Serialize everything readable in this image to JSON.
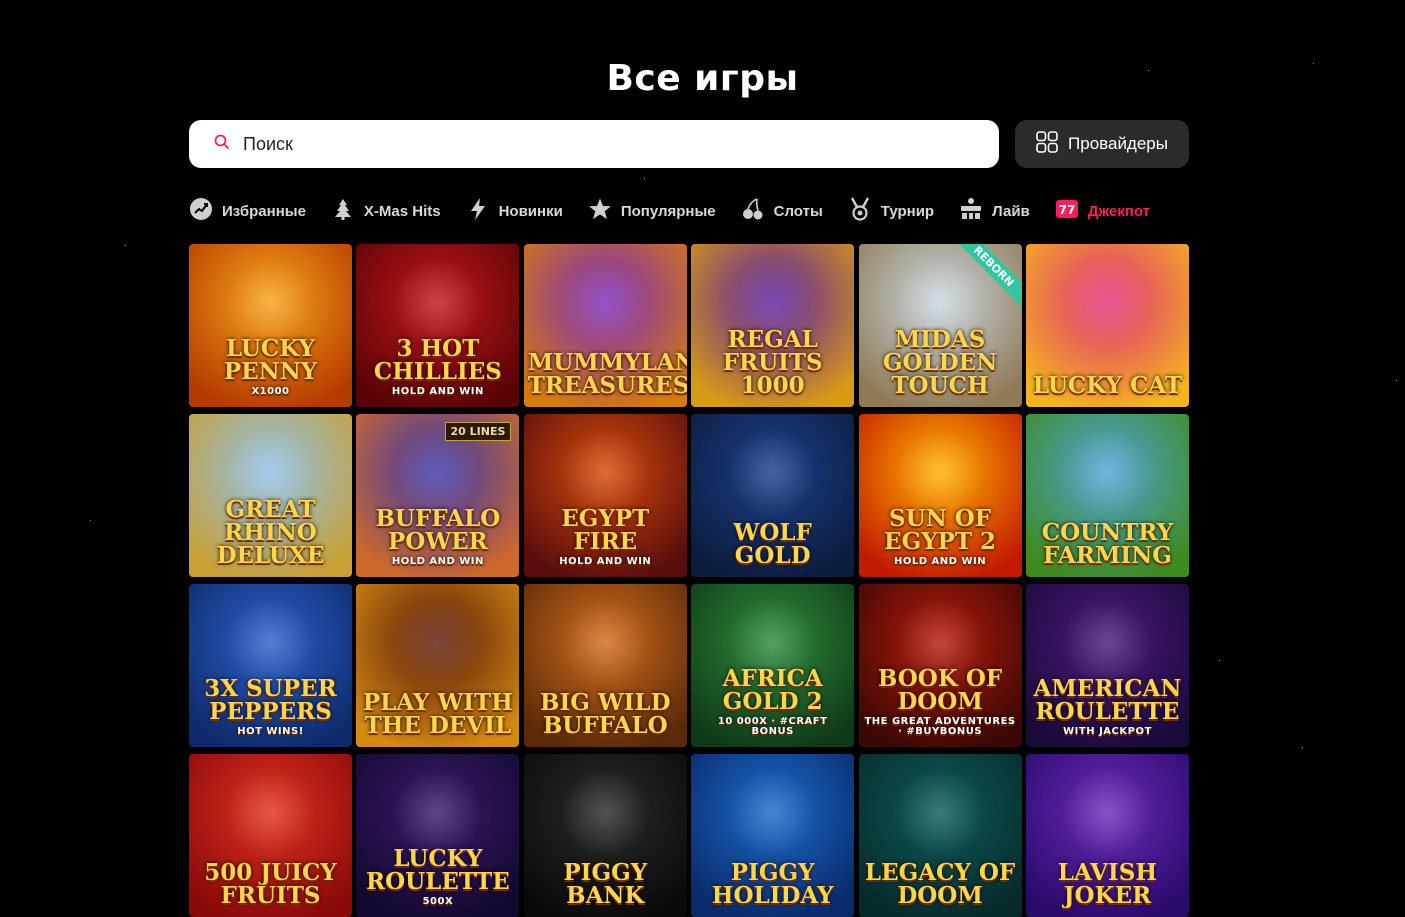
{
  "page": {
    "title": "Все игры"
  },
  "search": {
    "placeholder": "Поиск"
  },
  "providers_button": {
    "label": "Провайдеры"
  },
  "categories": [
    {
      "label": "Избранные",
      "icon": "favorites-icon",
      "active": false
    },
    {
      "label": "X-Mas Hits",
      "icon": "christmas-tree-icon",
      "active": false
    },
    {
      "label": "Новинки",
      "icon": "lightning-icon",
      "active": false
    },
    {
      "label": "Популярные",
      "icon": "star-icon",
      "active": false
    },
    {
      "label": "Слоты",
      "icon": "cherries-icon",
      "active": false
    },
    {
      "label": "Турнир",
      "icon": "medal-icon",
      "active": false
    },
    {
      "label": "Лайв",
      "icon": "live-table-icon",
      "active": false
    },
    {
      "label": "Джекпот",
      "icon": "seven-seven-icon",
      "active": true
    }
  ],
  "colors": {
    "accent": "#ff1e5a",
    "background": "#000000",
    "providers_button": "#2b2b2b"
  },
  "games": [
    {
      "title": "Lucky Penny",
      "sub": "X1000",
      "bg": [
        "#f6a21a",
        "#b53a00"
      ]
    },
    {
      "title": "3 Hot Chillies",
      "sub": "HOLD AND WIN",
      "bg": [
        "#c0171a",
        "#5a0306"
      ]
    },
    {
      "title": "Mummyland Treasures",
      "sub": "",
      "bg": [
        "#7a2bb8",
        "#d77a10"
      ]
    },
    {
      "title": "Regal Fruits 1000",
      "sub": "",
      "bg": [
        "#5a1fa0",
        "#d99a15"
      ]
    },
    {
      "title": "Midas Golden Touch",
      "sub": "",
      "bg": [
        "#c9d6e0",
        "#8f7a55"
      ],
      "badge": "REBORN"
    },
    {
      "title": "Lucky Cat",
      "sub": "",
      "bg": [
        "#e0307a",
        "#f4b51e"
      ]
    },
    {
      "title": "Great Rhino Deluxe",
      "sub": "",
      "bg": [
        "#8ec1e8",
        "#c9a034"
      ]
    },
    {
      "title": "Buffalo Power",
      "sub": "HOLD AND WIN",
      "bg": [
        "#3a36a8",
        "#d06a2b"
      ],
      "badge": "20 LINES"
    },
    {
      "title": "Egypt Fire",
      "sub": "HOLD AND WIN",
      "bg": [
        "#d44a0a",
        "#5a0d0d"
      ]
    },
    {
      "title": "Wolf Gold",
      "sub": "",
      "bg": [
        "#1c3f8a",
        "#0b1c3d"
      ]
    },
    {
      "title": "Sun of Egypt 2",
      "sub": "HOLD AND WIN",
      "bg": [
        "#ffb000",
        "#c21a00"
      ]
    },
    {
      "title": "Country Farming",
      "sub": "",
      "bg": [
        "#4fa3d8",
        "#3e8b1e"
      ]
    },
    {
      "title": "3x Super Peppers",
      "sub": "HOT WINS!",
      "bg": [
        "#2a60c8",
        "#0e2a6a"
      ]
    },
    {
      "title": "Play With The Devil",
      "sub": "",
      "bg": [
        "#5a1a08",
        "#d58a14"
      ]
    },
    {
      "title": "Big Wild Buffalo",
      "sub": "",
      "bg": [
        "#d06a1a",
        "#5a2a0a"
      ]
    },
    {
      "title": "Africa Gold 2",
      "sub": "10 000x · #CRAFT BONUS",
      "bg": [
        "#2d8a3a",
        "#0f3a18"
      ]
    },
    {
      "title": "Book of Doom",
      "sub": "The Great Adventures · #BUYBONUS",
      "bg": [
        "#b31a0a",
        "#3a0805"
      ]
    },
    {
      "title": "American Roulette",
      "sub": "WITH JACKPOT",
      "bg": [
        "#4a1a7a",
        "#1a0a3a"
      ]
    },
    {
      "title": "500 Juicy Fruits",
      "sub": "",
      "bg": [
        "#e03020",
        "#8a0a0a"
      ]
    },
    {
      "title": "Lucky Roulette",
      "sub": "500x",
      "bg": [
        "#3a1a6a",
        "#120830"
      ]
    },
    {
      "title": "Piggy Bank",
      "sub": "",
      "bg": [
        "#2a2a2a",
        "#0a0a0a"
      ]
    },
    {
      "title": "Piggy Holiday",
      "sub": "",
      "bg": [
        "#1a6ac8",
        "#0a2a6a"
      ]
    },
    {
      "title": "Legacy of Doom",
      "sub": "",
      "bg": [
        "#0e5a5a",
        "#062a2a"
      ]
    },
    {
      "title": "Lavish Joker",
      "sub": "",
      "bg": [
        "#6a2ab8",
        "#2a0a6a"
      ]
    }
  ]
}
